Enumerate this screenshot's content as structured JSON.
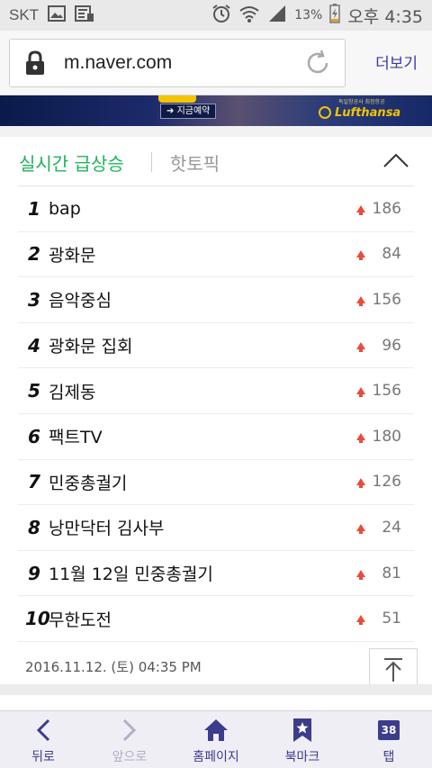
{
  "status_bar": {
    "carrier": "SKT",
    "battery_percent": "13%",
    "time": "오후 4:35",
    "icons": [
      "gallery-icon",
      "news-icon",
      "alarm-icon",
      "wifi-icon",
      "signal-icon",
      "battery-charging-icon"
    ]
  },
  "browser": {
    "url": "m.naver.com",
    "more_label": "더보기"
  },
  "ad": {
    "cta": "지금예약",
    "small_text": "독일항공사 최정항공",
    "brand": "Lufthansa"
  },
  "trending": {
    "tab_active": "실시간 급상승",
    "tab_inactive": "핫토픽",
    "items": [
      {
        "rank": "1",
        "keyword": "bap",
        "change": "186"
      },
      {
        "rank": "2",
        "keyword": "광화문",
        "change": "84"
      },
      {
        "rank": "3",
        "keyword": "음악중심",
        "change": "156"
      },
      {
        "rank": "4",
        "keyword": "광화문 집회",
        "change": "96"
      },
      {
        "rank": "5",
        "keyword": "김제동",
        "change": "156"
      },
      {
        "rank": "6",
        "keyword": "팩트TV",
        "change": "180"
      },
      {
        "rank": "7",
        "keyword": "민중총궐기",
        "change": "126"
      },
      {
        "rank": "8",
        "keyword": "낭만닥터 김사부",
        "change": "24"
      },
      {
        "rank": "9",
        "keyword": "11월 12일 민중총궐기",
        "change": "81"
      },
      {
        "rank": "10",
        "keyword": "무한도전",
        "change": "51"
      }
    ],
    "timestamp": "2016.11.12. (토) 04:35 PM"
  },
  "bottom_nav": {
    "back": "뒤로",
    "forward": "앞으로",
    "home": "홈페이지",
    "bookmark": "북마크",
    "tabs": "탭",
    "tab_count": "38"
  },
  "colors": {
    "accent_green": "#1fb45a",
    "nav_purple": "#3c3c8c",
    "up_red": "#e84c3d"
  }
}
